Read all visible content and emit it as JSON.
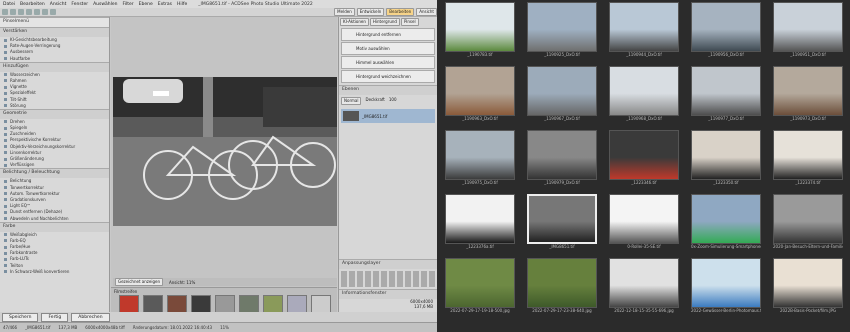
{
  "app": {
    "title": "_IMG8651.tif - ACDSee Photo Studio Ultimate 2022",
    "menu": [
      "Datei",
      "Bearbeiten",
      "Ansicht",
      "Fenster",
      "Auswählen",
      "Filter",
      "Ebene",
      "Extras",
      "Hilfe"
    ],
    "toolbar": {
      "save_mode": "Speichern",
      "done": "Fertig",
      "cancel": "Abbrechen",
      "right_tabs": [
        "Entwickeln",
        "Bearbeiten",
        "Ansicht"
      ],
      "meet_label": "Melden"
    }
  },
  "left_panel": {
    "title": "Pinselmenü",
    "sections": [
      {
        "title": "Verstärken",
        "items": [
          "KI-Gesichtsbearbeitung",
          "Rote-Augen-Verringerung",
          "Ausbessern",
          "Hautfarbe"
        ]
      },
      {
        "title": "Hinzufügen",
        "items": [
          "Wasserzeichen",
          "Rahmen",
          "Vignette",
          "Spezialeffekt",
          "Tilt-Shift",
          "Störung"
        ]
      },
      {
        "title": "Geometrie",
        "items": [
          "Drehen",
          "Spiegeln",
          "Zuschneiden",
          "Perspektivische Korrektur",
          "Objektiv-Verzeichnungskorrektur",
          "Linsenkorrektur",
          "Größenänderung",
          "Verflüssigen"
        ]
      },
      {
        "title": "Belichtung / Beleuchtung",
        "items": [
          "Belichtung",
          "Tonwertkorrektur",
          "Autom. Tonwertkorrektur",
          "Gradationskurven",
          "Light EQ™",
          "Dunst entfernen (Dehaze)",
          "Abwedeln und Nachbelichten"
        ]
      },
      {
        "title": "Farbe",
        "items": [
          "Weißabgleich",
          "Farb-EQ",
          "Farbe/Hue",
          "Farbkontraste",
          "Farb-LUTs",
          "Teilton",
          "In Schwarz-Weiß konvertieren"
        ]
      }
    ]
  },
  "right_panel": {
    "tabs": [
      "KI-Aktionen",
      "Hintergrund",
      "Pinsel"
    ],
    "actions": [
      "Hintergrund entfernen",
      "Motiv auswählen",
      "Himmel auswählen",
      "Hintergrund weichzeichnen"
    ],
    "layers_title": "Ebenen",
    "blend_mode": "Normal",
    "opacity_label": "Deckkraft",
    "opacity_value": "100",
    "layer_name": "_IMG8651.tif",
    "adjust_title": "Anpassungslayer",
    "info_title": "Informationsfenster",
    "info_values": [
      "6000x4000",
      "137,6 MB"
    ]
  },
  "canvas": {
    "zoom_label": "Gezeichnet anzeigen",
    "view_label": "Ansicht: 11%"
  },
  "filmstrip_title": "Filmstreifen",
  "statusbar": [
    "47/466",
    "_IMG8651.tif",
    "137,3 MB",
    "6000x4000x48b tiff",
    "Änderungsdatum: 18.01.2022 16:40:43",
    "11%"
  ],
  "gallery": [
    {
      "cap": "_1190783.tif",
      "bg": "#dfe7ea",
      "c": "#5c8a3e"
    },
    {
      "cap": "_1190925_DxO.tif",
      "bg": "#9fb0c2",
      "c": "#6f6f6f"
    },
    {
      "cap": "_1190944_DxO.tif",
      "bg": "#b9c8d6",
      "c": "#444"
    },
    {
      "cap": "_1190956_DxO.tif",
      "bg": "#a6b3c0",
      "c": "#3f4a52"
    },
    {
      "cap": "_1190951_DxO.tif",
      "bg": "#c9d1d9",
      "c": "#555"
    },
    {
      "cap": "_1190963_DxO.tif",
      "bg": "#b2a394",
      "c": "#8a5a3a"
    },
    {
      "cap": "_1190967_DxO.tif",
      "bg": "#9cabba",
      "c": "#666"
    },
    {
      "cap": "_1190968_DxO.tif",
      "bg": "#d8dde2",
      "c": "#888"
    },
    {
      "cap": "_1190977_DxO.tif",
      "bg": "#c0c6cc",
      "c": "#4d4d4d"
    },
    {
      "cap": "_1190973_DxO.tif",
      "bg": "#b4a99c",
      "c": "#6b4e3a"
    },
    {
      "cap": "_1190975_DxO.tif",
      "bg": "#a7b2bb",
      "c": "#3c3c3c"
    },
    {
      "cap": "_1190979_DxO.tif",
      "bg": "#888",
      "c": "#333"
    },
    {
      "cap": "_1223346.tif",
      "bg": "#3a3a3a",
      "c": "#c0392b"
    },
    {
      "cap": "_1223350.tif",
      "bg": "#d9d2c8",
      "c": "#222"
    },
    {
      "cap": "_1223374.tif",
      "bg": "#e6e1d9",
      "c": "#222"
    },
    {
      "cap": "_1223376a.tif",
      "bg": "#f2f2f2",
      "c": "#1a1a1a"
    },
    {
      "cap": "_IMG8651.tif",
      "bg": "#777",
      "c": "#222"
    },
    {
      "cap": "0-Rollei-35-SE.tif",
      "bg": "#f4f4f4",
      "c": "#555"
    },
    {
      "cap": "0x-Zoom-Simulierung-Smartphones-17-rec...",
      "bg": "#8fa8c2",
      "c": "#3a5"
    },
    {
      "cap": "2020-Jan-Besuch-Eltern-und-Familie.jpg",
      "bg": "#9a9a9a",
      "c": "#333"
    },
    {
      "cap": "2022-07-29-17-19-18-500.jpg",
      "bg": "#6f8a45",
      "c": "#4c6630"
    },
    {
      "cap": "2022-07-29-17-23-38-640.jpg",
      "bg": "#66803d",
      "c": "#3e5a2a"
    },
    {
      "cap": "2022-12-18-15-35-55-696.jpg",
      "bg": "#e1e1e1",
      "c": "#444"
    },
    {
      "cap": "2022-Gewässer-Berlin-Photomaus.tif",
      "bg": "#cde0ec",
      "c": "#3b7bbf"
    },
    {
      "cap": "2022B-Basis-Pocket/film.JPG",
      "bg": "#e9e0d3",
      "c": "#333"
    }
  ],
  "film_colors": [
    "#c0392b",
    "#5a5a5a",
    "#7a4a3a",
    "#3a3a3a",
    "#999",
    "#6f7a6a",
    "#8a9a5a",
    "#aab",
    "#ccc"
  ]
}
